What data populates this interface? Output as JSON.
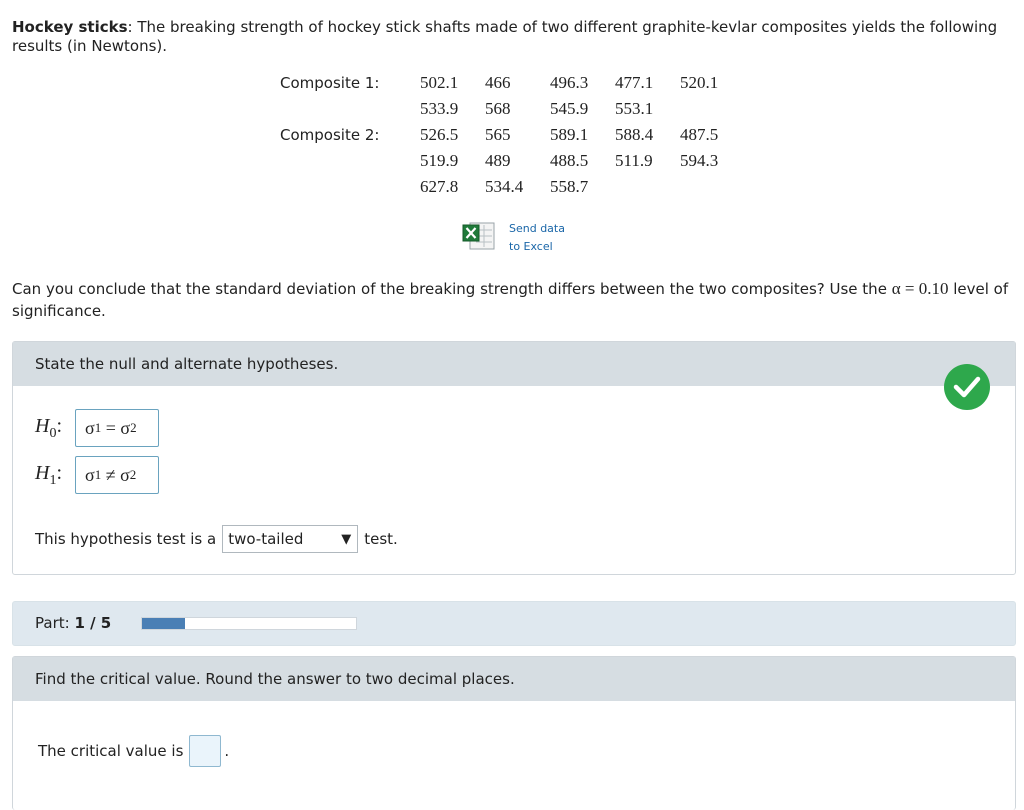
{
  "problem": {
    "title": "Hockey sticks",
    "intro": ": The breaking strength of hockey stick shafts made of two different graphite-kevlar composites yields the following results (in Newtons)."
  },
  "data_table": {
    "composite1_label": "Composite 1:",
    "composite2_label": "Composite 2:",
    "composite1_rows": [
      [
        "502.1",
        "466",
        "496.3",
        "477.1",
        "520.1"
      ],
      [
        "533.9",
        "568",
        "545.9",
        "553.1",
        ""
      ]
    ],
    "composite2_rows": [
      [
        "526.5",
        "565",
        "589.1",
        "588.4",
        "487.5"
      ],
      [
        "519.9",
        "489",
        "488.5",
        "511.9",
        "594.3"
      ],
      [
        "627.8",
        "534.4",
        "558.7",
        "",
        ""
      ]
    ]
  },
  "excel": {
    "line1": "Send data",
    "line2": "to Excel",
    "icon": "excel-icon"
  },
  "question": {
    "text_before": "Can you conclude that the standard deviation of the breaking strength differs between the two composites? Use the ",
    "alpha_expr": "α = 0.10",
    "text_after": " level of significance."
  },
  "hypotheses_panel": {
    "heading": "State the null and alternate hypotheses.",
    "status_icon": "checkmark-icon",
    "status_color": "#2ea84c",
    "h0": {
      "label": "H",
      "sub": "0",
      "lhs": "σ",
      "lhs_sub": "1",
      "op": " = ",
      "rhs": "σ",
      "rhs_sub": "2"
    },
    "h1": {
      "label": "H",
      "sub": "1",
      "lhs": "σ",
      "lhs_sub": "1",
      "op": " ≠ ",
      "rhs": "σ",
      "rhs_sub": "2"
    },
    "sentence_before": "This hypothesis test is a",
    "tail_selected": "two-tailed",
    "sentence_after": "test."
  },
  "part": {
    "label": "Part: ",
    "current": "1 / 5",
    "progress_fraction": 0.2,
    "bar_color": "#4a7fb5"
  },
  "critical_panel": {
    "heading": "Find the critical value. Round the answer to two decimal places.",
    "prompt": "The critical value is",
    "answer": "",
    "suffix": "."
  }
}
